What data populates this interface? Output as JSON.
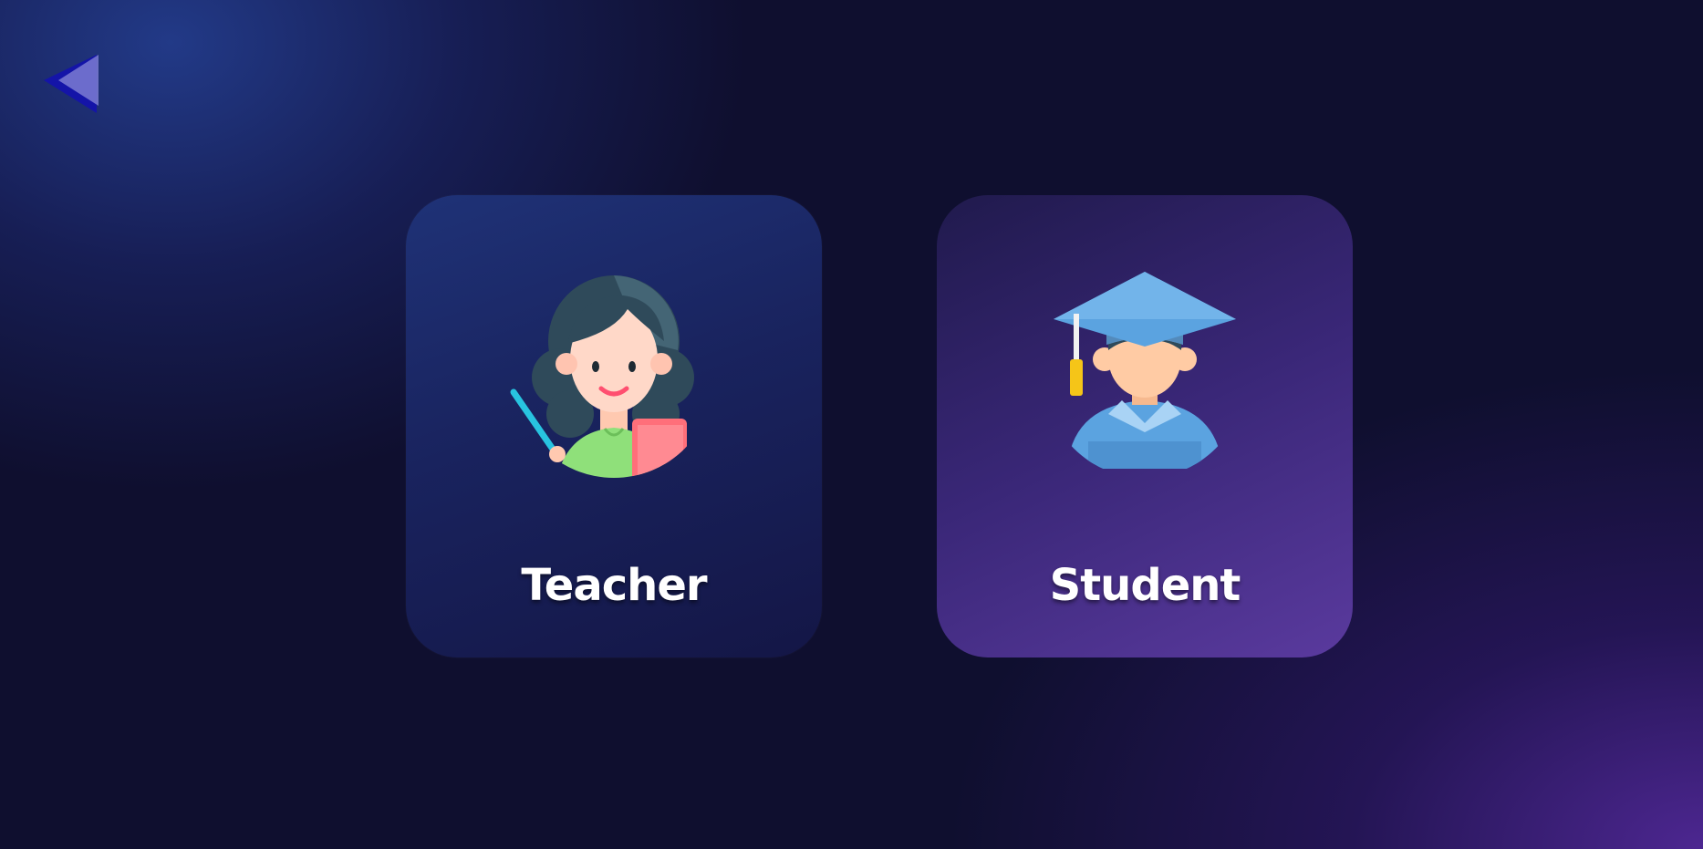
{
  "nav": {
    "back_icon": "chevron-left-icon"
  },
  "roles": {
    "teacher": {
      "label": "Teacher",
      "icon": "teacher-avatar-icon",
      "color": "#1f3277"
    },
    "student": {
      "label": "Student",
      "icon": "student-graduate-icon",
      "color": "#5a3a9e"
    }
  }
}
